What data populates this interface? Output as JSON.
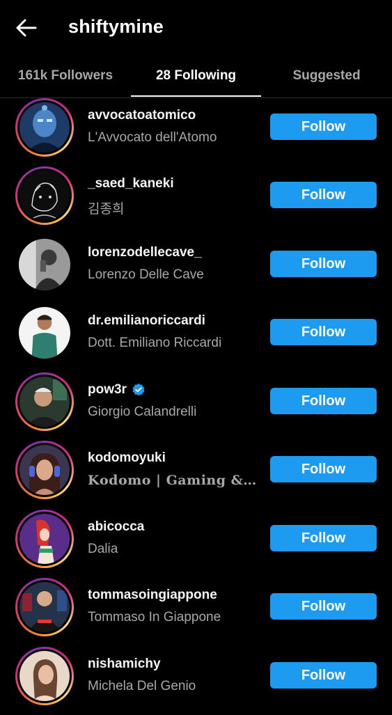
{
  "header": {
    "title": "shiftymine",
    "back_icon": "arrow-left-icon"
  },
  "tabs": [
    {
      "label": "161k Followers",
      "active": false
    },
    {
      "label": "28 Following",
      "active": true
    },
    {
      "label": "Suggested",
      "active": false
    }
  ],
  "accent_color": "#1d9bf0",
  "users": [
    {
      "username": "avvocatoatomico",
      "full_name": "L'Avvocato dell'Atomo",
      "button": "Follow",
      "verified": false
    },
    {
      "username": "_saed_kaneki",
      "full_name": "김종희",
      "button": "Follow",
      "verified": false
    },
    {
      "username": "lorenzodellecave_",
      "full_name": "Lorenzo Delle Cave",
      "button": "Follow",
      "verified": false
    },
    {
      "username": "dr.emilianoriccardi",
      "full_name": "Dott. Emiliano Riccardi",
      "button": "Follow",
      "verified": false
    },
    {
      "username": "pow3r",
      "full_name": "Giorgio Calandrelli",
      "button": "Follow",
      "verified": true
    },
    {
      "username": "kodomoyuki",
      "full_name": "𝐊𝐨𝐝𝐨𝐦𝐨 | 𝐆𝐚𝐦𝐢𝐧𝐠 & V...",
      "button": "Follow",
      "verified": false
    },
    {
      "username": "abicocca",
      "full_name": "Dalia",
      "button": "Follow",
      "verified": false
    },
    {
      "username": "tommasoingiappone",
      "full_name": "Tommaso In Giappone",
      "button": "Follow",
      "verified": false
    },
    {
      "username": "nishamichy",
      "full_name": "Michela Del Genio",
      "button": "Follow",
      "verified": false
    }
  ]
}
